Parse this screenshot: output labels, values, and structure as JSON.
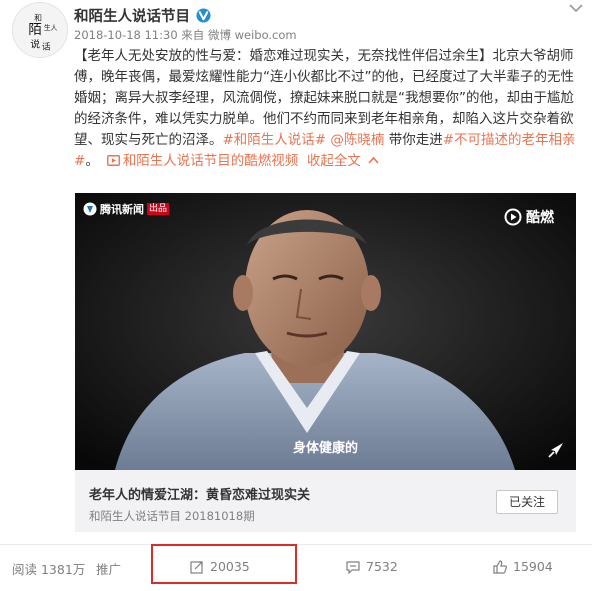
{
  "author": {
    "name": "和陌生人说话节目",
    "avatar_text": "陌生人说话",
    "verified_badge": "v-badge-icon"
  },
  "post": {
    "meta": "2018-10-18 11:30 来自 微博 weibo.com",
    "body_prefix": "【老年人无处安放的性与爱：婚恋难过现实关，无奈找性伴侣过余生】北京大爷胡师傅，晚年丧偶，最爱炫耀性能力“连小伙都比不过”的他，已经度过了大半辈子的无性婚姻；离异大叔李经理，风流倜傥，撩起妹来脱口就是“我想要你”的他，却由于尴尬的经济条件，难以凭实力脱单。他们不约而同来到老年相亲角，却陷入这片交杂着欲望、现实与死亡的沼泽。",
    "hashtag1": "#和陌生人说话#",
    "mention": "@陈晓楠",
    "middle": " 带你走进",
    "hashtag2": "#不可描述的老年相亲#",
    "end": "。",
    "video_link": "和陌生人说话节目的酷燃视频",
    "collapse": "收起全文"
  },
  "video": {
    "watermark_left": "腾讯新闻",
    "watermark_badge": "出品",
    "watermark_right": "酷燃",
    "subtitle": "身体健康的"
  },
  "card": {
    "title": "老年人的情爱江湖：黄昏恋难过现实关",
    "subtitle": "和陌生人说话节目 20181018期",
    "follow_button": "已关注"
  },
  "toolbar": {
    "reads": "阅读 1381万",
    "promote": "推广",
    "reposts": "20035",
    "comments": "7532",
    "likes": "15904"
  },
  "colors": {
    "link": "#eb7350",
    "highlight": "#e02b2b",
    "card_bg": "#f2f2f5"
  }
}
